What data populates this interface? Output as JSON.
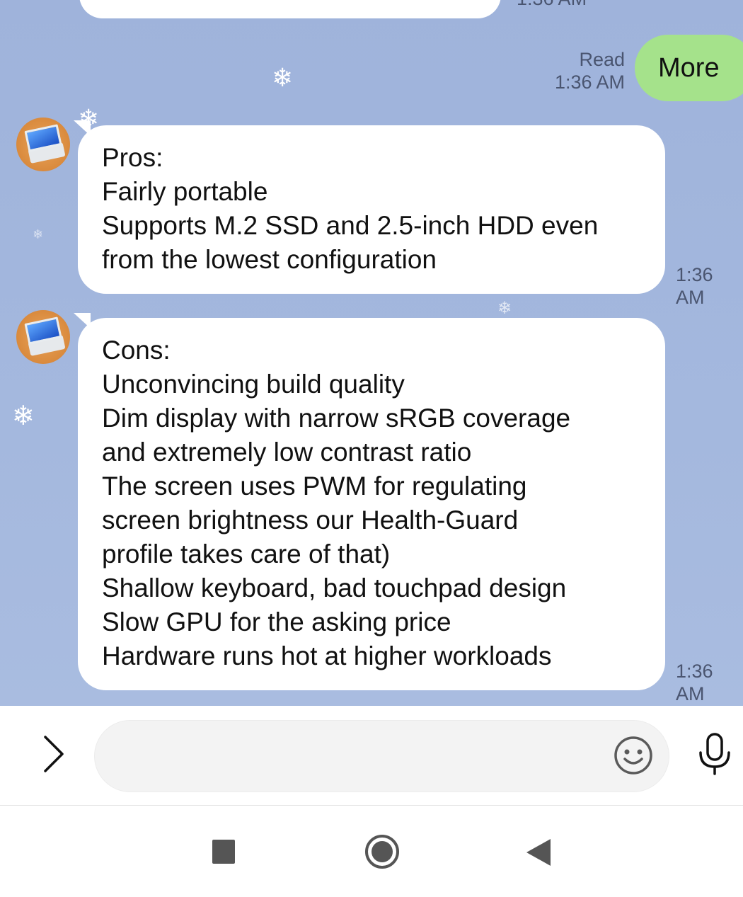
{
  "conversation": {
    "previous_timestamp": "1:36 AM",
    "sent_message": {
      "text": "More",
      "read_label": "Read",
      "time": "1:36 AM"
    },
    "received_messages": [
      {
        "time": "1:36 AM",
        "lines": [
          "Pros:",
          "Fairly portable",
          "Supports M.2 SSD and 2.5-inch HDD even",
          "from the lowest configuration"
        ]
      },
      {
        "time": "1:36 AM",
        "lines": [
          "Cons:",
          "Unconvincing build quality",
          "Dim display with narrow sRGB coverage",
          "and extremely low contrast ratio",
          "The screen uses PWM for regulating",
          "screen brightness our Health-Guard",
          "profile takes care of that)",
          "Shallow keyboard, bad touchpad design",
          "Slow GPU for the asking price",
          "Hardware runs hot at higher workloads"
        ]
      }
    ]
  },
  "composer": {
    "expand_icon": "chevron-right-icon",
    "input_value": "",
    "input_placeholder": "",
    "emoji_icon": "smiley-icon",
    "voice_icon": "microphone-icon"
  },
  "system_nav": {
    "recents_icon": "square-icon",
    "home_icon": "circle-icon",
    "back_icon": "triangle-back-icon"
  },
  "colors": {
    "chat_background": "#a2b6dd",
    "sent_bubble": "#a5e28b",
    "received_bubble": "#ffffff"
  }
}
